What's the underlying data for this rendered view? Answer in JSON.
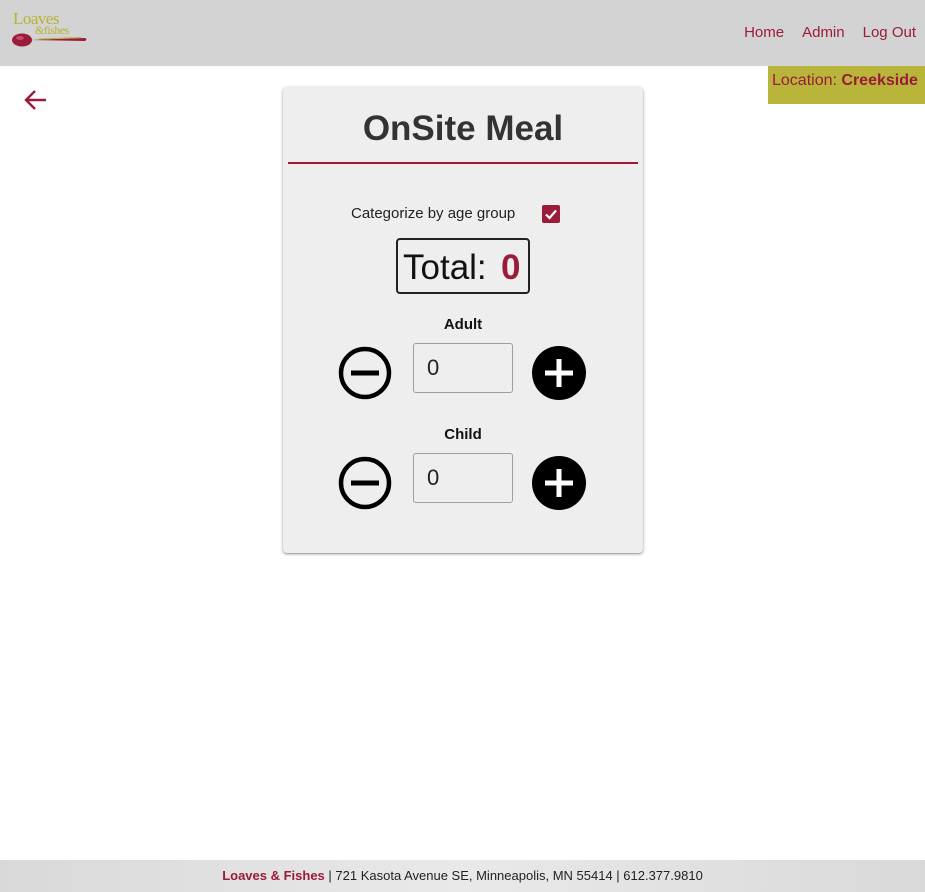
{
  "header": {
    "logo": {
      "line1": "Loaves",
      "line2": "&fishes"
    },
    "nav": {
      "home": "Home",
      "admin": "Admin",
      "logout": "Log Out"
    }
  },
  "location": {
    "label": "Location:",
    "name": "Creekside"
  },
  "card": {
    "title": "OnSite Meal",
    "categorize_label": "Categorize by age group",
    "categorize_checked": true,
    "total_label": "Total:",
    "total_value": "0",
    "groups": [
      {
        "label": "Adult",
        "value": "0"
      },
      {
        "label": "Child",
        "value": "0"
      }
    ]
  },
  "footer": {
    "org": "Loaves & Fishes",
    "details": " | 721 Kasota Avenue SE, Minneapolis, MN 55414 | 612.377.9810"
  },
  "colors": {
    "brand": "#9a1b3a",
    "accent": "#b8b53a",
    "header_bg": "#d3d3d3",
    "card_bg": "#eeeeee"
  },
  "icons": {
    "back": "arrow-left-icon",
    "minus": "minus-circle-outline-icon",
    "plus": "plus-circle-filled-icon",
    "check": "check-icon"
  }
}
